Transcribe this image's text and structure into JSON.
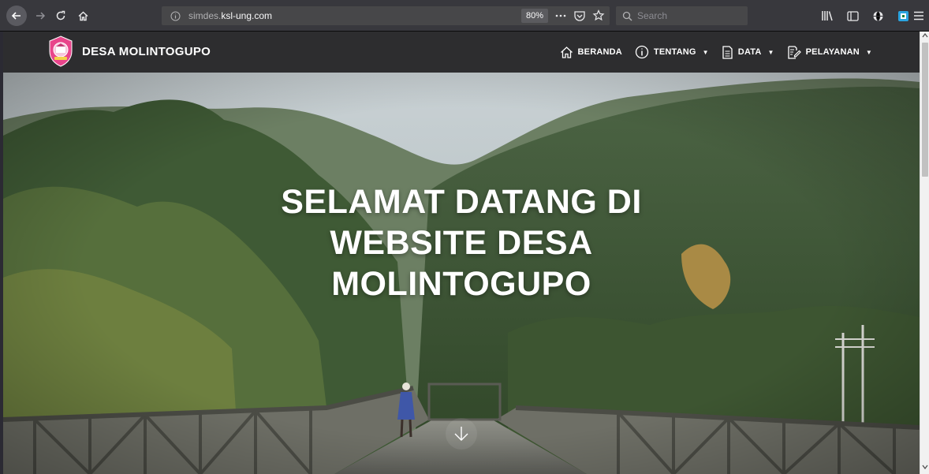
{
  "browser": {
    "url_prefix": "simdes.",
    "url_domain": "ksl-ung.com",
    "zoom": "80%",
    "search_placeholder": "Search"
  },
  "site": {
    "brand_name": "DESA MOLINTOGUPO",
    "nav": [
      {
        "label": "BERANDA",
        "icon": "home-icon",
        "dropdown": false
      },
      {
        "label": "TENTANG",
        "icon": "info-icon",
        "dropdown": true
      },
      {
        "label": "DATA",
        "icon": "document-icon",
        "dropdown": true
      },
      {
        "label": "PELAYANAN",
        "icon": "edit-document-icon",
        "dropdown": true
      }
    ]
  },
  "hero": {
    "title_lines": [
      "SELAMAT DATANG DI",
      "WEBSITE DESA",
      "MOLINTOGUPO"
    ]
  },
  "colors": {
    "navbar_bg": "#2d2d2f",
    "toolbar_bg": "#38383d",
    "logo_pink": "#e8458b"
  }
}
